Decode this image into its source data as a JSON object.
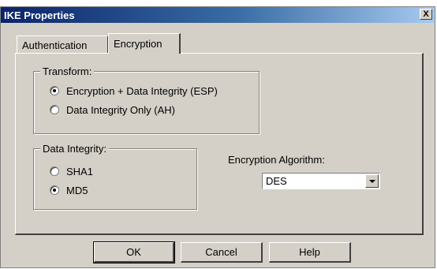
{
  "window": {
    "title": "IKE Properties",
    "close_label": "X"
  },
  "tabs": [
    {
      "label": "Authentication",
      "selected": false
    },
    {
      "label": "Encryption",
      "selected": true
    }
  ],
  "transform": {
    "legend": "Transform:",
    "options": [
      {
        "label": "Encryption + Data Integrity (ESP)",
        "checked": true
      },
      {
        "label": "Data Integrity Only (AH)",
        "checked": false
      }
    ]
  },
  "data_integrity": {
    "legend": "Data Integrity:",
    "options": [
      {
        "label": "SHA1",
        "checked": false
      },
      {
        "label": "MD5",
        "checked": true
      }
    ]
  },
  "encryption_algorithm": {
    "label": "Encryption Algorithm:",
    "value": "DES"
  },
  "buttons": {
    "ok": "OK",
    "cancel": "Cancel",
    "help": "Help"
  }
}
